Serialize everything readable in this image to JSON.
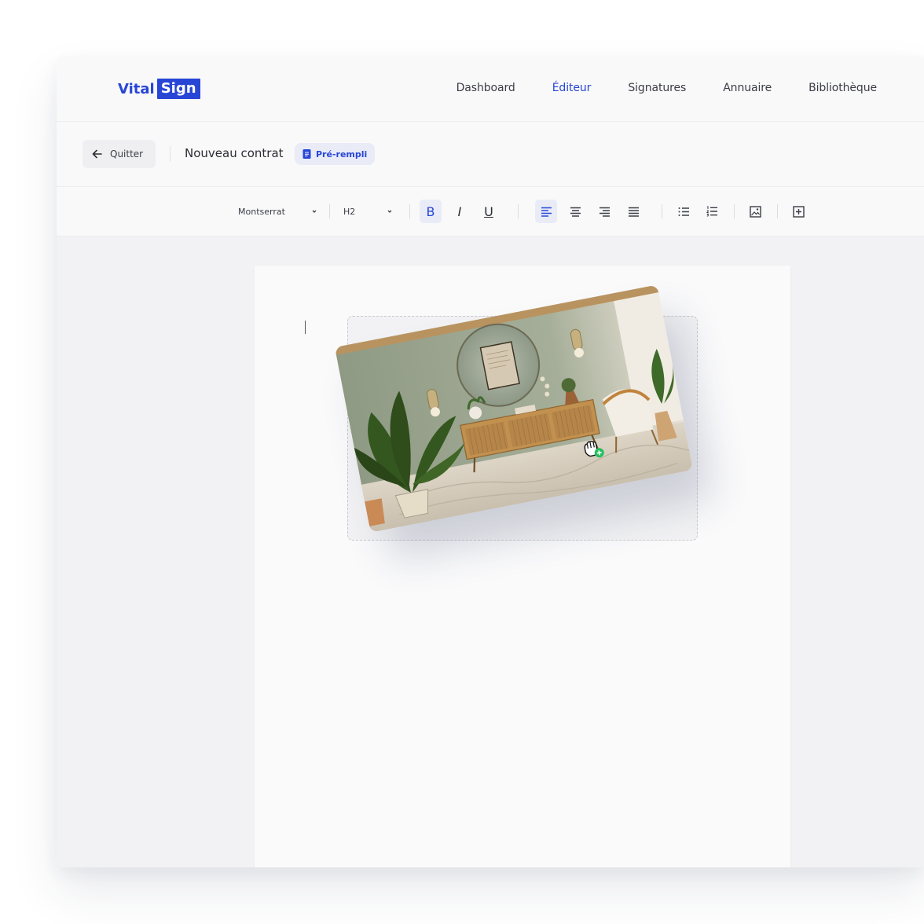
{
  "brand": {
    "name_part1": "Vital",
    "name_part2": "Sign",
    "color": "#2846d6"
  },
  "nav": {
    "items": [
      {
        "label": "Dashboard",
        "active": false
      },
      {
        "label": "Éditeur",
        "active": true
      },
      {
        "label": "Signatures",
        "active": false
      },
      {
        "label": "Annuaire",
        "active": false
      },
      {
        "label": "Bibliothèque",
        "active": false
      }
    ]
  },
  "subheader": {
    "quit_label": "Quitter",
    "quit_icon": "arrow-left-icon",
    "doc_title": "Nouveau contrat",
    "badge_label": "Pré-rempli",
    "badge_icon": "document-icon"
  },
  "toolbar": {
    "font_family": "Montserrat",
    "heading_level": "H2",
    "bold_label": "B",
    "italic_label": "I",
    "underline_label": "U",
    "bold_active": true,
    "align_active": "left",
    "icons": [
      "chevron-down-icon",
      "align-left-icon",
      "align-center-icon",
      "align-right-icon",
      "align-justify-icon",
      "bullet-list-icon",
      "numbered-list-icon",
      "image-icon",
      "insert-block-icon"
    ]
  },
  "editor": {
    "dragged_item": "image",
    "drag_cursor_icon": "grab-hand-add-icon"
  }
}
